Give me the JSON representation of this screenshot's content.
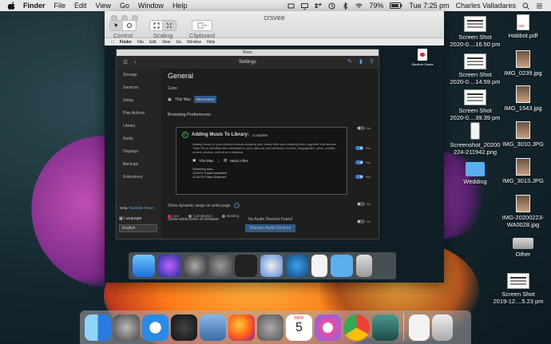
{
  "menubar": {
    "app": "Finder",
    "items": [
      "File",
      "Edit",
      "View",
      "Go",
      "Window",
      "Help"
    ],
    "battery": "79%",
    "clock": "Tue 7:25 pm",
    "user": "Charles Valladares"
  },
  "window": {
    "title": "crsvee",
    "toolbar": {
      "control_label": "Control",
      "scaling_label": "Scaling",
      "clipboard_label": "Clipboard"
    }
  },
  "remote": {
    "menubar": {
      "app": "Finder",
      "items": [
        "File",
        "Edit",
        "View",
        "Go",
        "Window",
        "Help"
      ]
    },
    "desktop_icon_label": "Stadium Cases",
    "roon": {
      "window_title": "Roon",
      "header_title": "Settings",
      "sidebar": [
        "Storage",
        "Services",
        "Setup",
        "Play Actions",
        "Library",
        "Audio",
        "Displays",
        "Backups",
        "Extensions"
      ],
      "help_prefix": "Help",
      "help_link": "Translate Roon!",
      "language_label": "Language",
      "language_value": "English",
      "main": {
        "title": "General",
        "core_label": "Core",
        "core_value": "This Mac",
        "disconnect": "Disconnect",
        "browsing": "Browsing Preferences",
        "row_dynamic": "Show dynamic range on artist page",
        "row_extra": "Show extra icons on browser",
        "toggle_no": "No",
        "toggle_yes": "Yes",
        "tags": [
          "Live",
          "Compilation",
          "Bootleg"
        ],
        "no_devices": "No Audio Devices Found",
        "manage_button": "Manage Audio Devices"
      },
      "modal": {
        "title": "Adding Music To Library:",
        "status": "Complete",
        "description": "Adding music to your library involves locating your music files and dumping them together into albums. Then Roon identifies the metadata for your albums, and retrieves reviews, biographies, lyrics, credits, covers, photos, and other metadata.",
        "source_left": "This Mac",
        "source_right": "Music Files",
        "scanning": "Scanning now...",
        "tracks": "114474 Tracks Imported",
        "files": "1216732 Files Scanned"
      }
    }
  },
  "desktop": {
    "icons": [
      {
        "label1": "Screen Shot",
        "label2": "2020-0....16.50 pm",
        "type": "screenshot"
      },
      {
        "label1": "Habbot.pdf",
        "label2": "",
        "type": "pdf"
      },
      {
        "label1": "Screen Shot",
        "label2": "2020-0....14.59 pm",
        "type": "screenshot"
      },
      {
        "label1": "IMG_0239.jpg",
        "label2": "",
        "type": "photo"
      },
      {
        "label1": "Screen Shot",
        "label2": "2020-0....39.39 pm",
        "type": "screenshot"
      },
      {
        "label1": "IMG_1543.jpg",
        "label2": "",
        "type": "photo"
      },
      {
        "label1": "Screenshot_20200",
        "label2": "224-211942.png",
        "type": "phone"
      },
      {
        "label1": "IMG_3010.JPG",
        "label2": "",
        "type": "photo"
      },
      {
        "label1": "Wedding",
        "label2": "",
        "type": "folder"
      },
      {
        "label1": "IMG_3013.JPG",
        "label2": "",
        "type": "photo"
      },
      {
        "label1": "IMG-20200223-",
        "label2": "WA0028.jpg",
        "type": "photo"
      },
      {
        "label1": "Other",
        "label2": "",
        "type": "drive"
      },
      {
        "label1": "Screen Shot",
        "label2": "2019-12....5.23 pm",
        "type": "screenshot"
      }
    ]
  },
  "dock": {
    "apps": [
      "finder-icon",
      "launchpad-icon",
      "safari-icon",
      "dashboard-icon",
      "preview-icon",
      "firefox-icon",
      "system-preferences-icon",
      "calendar-icon",
      "itunes-icon",
      "chrome-icon",
      "screens-icon",
      "document-icon",
      "trash-icon"
    ],
    "calendar_month": "MAY",
    "calendar_day": "5"
  }
}
